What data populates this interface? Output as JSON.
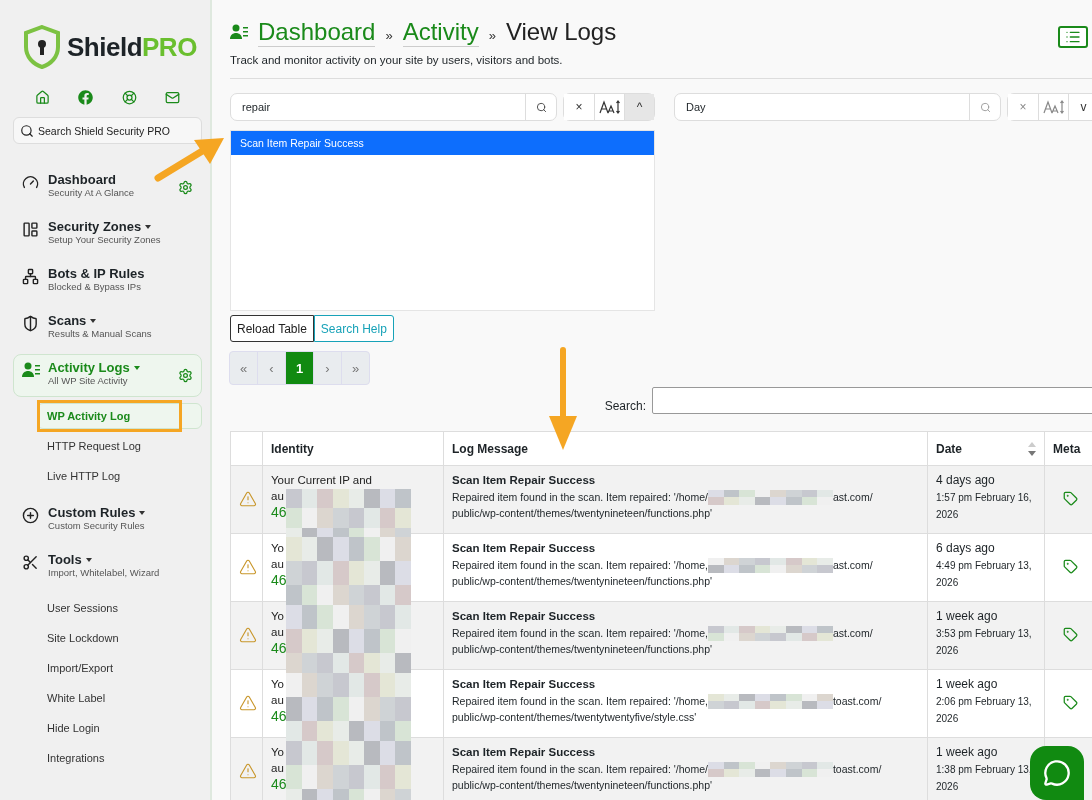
{
  "sidebar": {
    "logo": {
      "word": "Shield",
      "accent": "PRO"
    },
    "search": {
      "placeholder": "Search Shield Security PRO"
    },
    "nav": [
      {
        "title": "Dashboard",
        "subtitle": "Security At A Glance",
        "dropdown": false,
        "settings": true,
        "selected": false
      },
      {
        "title": "Security Zones",
        "subtitle": "Setup Your Security Zones",
        "dropdown": true,
        "settings": false,
        "selected": false
      },
      {
        "title": "Bots & IP Rules",
        "subtitle": "Blocked & Bypass IPs",
        "dropdown": false,
        "settings": false,
        "selected": false
      },
      {
        "title": "Scans",
        "subtitle": "Results & Manual Scans",
        "dropdown": true,
        "settings": false,
        "selected": false
      },
      {
        "title": "Activity Logs",
        "subtitle": "All WP Site Activity",
        "dropdown": true,
        "settings": true,
        "selected": true,
        "children": [
          {
            "label": "WP Activity Log",
            "selected": true,
            "highlighted": true
          },
          {
            "label": "HTTP Request Log",
            "selected": false,
            "highlighted": false
          },
          {
            "label": "Live HTTP Log",
            "selected": false,
            "highlighted": false
          }
        ]
      },
      {
        "title": "Custom Rules",
        "subtitle": "Custom Security Rules",
        "dropdown": true,
        "settings": false,
        "selected": false
      },
      {
        "title": "Tools",
        "subtitle": "Import, Whitelabel, Wizard",
        "dropdown": true,
        "settings": false,
        "selected": false,
        "children": [
          {
            "label": "User Sessions",
            "selected": false,
            "highlighted": false
          },
          {
            "label": "Site Lockdown",
            "selected": false,
            "highlighted": false
          },
          {
            "label": "Import/Export",
            "selected": false,
            "highlighted": false
          },
          {
            "label": "White Label",
            "selected": false,
            "highlighted": false
          },
          {
            "label": "Hide Login",
            "selected": false,
            "highlighted": false
          },
          {
            "label": "Integrations",
            "selected": false,
            "highlighted": false
          }
        ]
      }
    ]
  },
  "header": {
    "breadcrumbs": [
      {
        "label": "Dashboard",
        "link": true
      },
      {
        "label": "Activity",
        "link": true
      },
      {
        "label": "View Logs",
        "link": false
      }
    ],
    "separator": "»",
    "description": "Track and monitor activity on your site by users, visitors and bots."
  },
  "filters": [
    {
      "value": "repair",
      "clear": "×",
      "toggle": "^",
      "expanded": true,
      "options": [
        {
          "label": "Scan Item Repair Success",
          "selected": true
        }
      ]
    },
    {
      "value": "Day",
      "clear": "×",
      "toggle": "v",
      "expanded": false
    }
  ],
  "actions": [
    "Reload Table",
    "Search Help"
  ],
  "pagination": [
    {
      "label": "«",
      "selected": false
    },
    {
      "label": "‹",
      "selected": false
    },
    {
      "label": "1",
      "selected": true
    },
    {
      "label": "›",
      "selected": false
    },
    {
      "label": "»",
      "selected": false
    }
  ],
  "table_search": {
    "label": "Search:"
  },
  "table": {
    "columns": [
      {
        "sortable": false
      },
      {
        "label": "Identity",
        "sortable": false
      },
      {
        "label": "Log Message",
        "sortable": false
      },
      {
        "label": "Date",
        "sortable": true
      },
      {
        "label": "Meta",
        "sortable": false
      }
    ],
    "rows": [
      {
        "identity": [
          "Your Current IP and",
          "au",
          "46"
        ],
        "title": "Scan Item Repair Success",
        "message_start": "Repaired item found in the scan. Item repaired: '/home/",
        "message_end": "ast.com/",
        "path": "public/wp-content/themes/twentynineteen/functions.php'",
        "ago": "4 days ago",
        "when": "1:57 pm February 16, 2026",
        "meta": true
      },
      {
        "identity": [
          "Yo",
          "au",
          "46"
        ],
        "title": "Scan Item Repair Success",
        "message_start": "Repaired item found in the scan. Item repaired: '/home,",
        "message_end": "ast.com/",
        "path": "public/wp-content/themes/twentynineteen/functions.php'",
        "ago": "6 days ago",
        "when": "4:49 pm February 13, 2026",
        "meta": true
      },
      {
        "identity": [
          "Yo",
          "au",
          "46"
        ],
        "title": "Scan Item Repair Success",
        "message_start": "Repaired item found in the scan. Item repaired: '/home,",
        "message_end": "ast.com/",
        "path": "public/wp-content/themes/twentynineteen/functions.php'",
        "ago": "1 week ago",
        "when": "3:53 pm February 13, 2026",
        "meta": true
      },
      {
        "identity": [
          "Yo",
          "au",
          "46"
        ],
        "title": "Scan Item Repair Success",
        "message_start": "Repaired item found in the scan. Item repaired: '/home,",
        "message_end": "toast.com/",
        "path": "public/wp-content/themes/twentytwentyfive/style.css'",
        "ago": "1 week ago",
        "when": "2:06 pm February 13, 2026",
        "meta": true
      },
      {
        "identity": [
          "Yo",
          "au",
          "46"
        ],
        "title": "Scan Item Repair Success",
        "message_start": "Repaired item found in the scan. Item repaired: '/home/",
        "message_end": "toast.com/",
        "path": "public/wp-content/themes/twentynineteen/functions.php'",
        "ago": "1 week ago",
        "when": "1:38 pm February 13, 2026",
        "meta": false
      }
    ]
  }
}
